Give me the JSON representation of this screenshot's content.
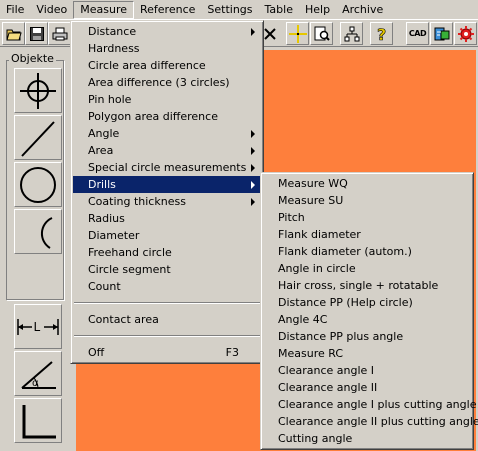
{
  "menubar": {
    "items": [
      "File",
      "Video",
      "Measure",
      "Reference",
      "Settings",
      "Table",
      "Help",
      "Archive"
    ],
    "active": "Measure"
  },
  "toolbar": {
    "left_icons": [
      "open-folder-icon",
      "save-icon",
      "print-icon"
    ],
    "right_icons": [
      "close-x-icon",
      "crosshair-icon",
      "zoom-document-icon",
      "network-icon",
      "help-icon",
      "cad-icon",
      "export-icon",
      "settings-gear-icon"
    ],
    "cad_label": "CAD"
  },
  "left_panel": {
    "group_label": "Objekte",
    "tools": [
      "crosshair-point-icon",
      "line-icon",
      "circle-icon",
      "arc-icon",
      "length-icon",
      "angle-icon",
      "corner-icon"
    ],
    "length_label": "L",
    "angle_label": "α"
  },
  "measure_menu": {
    "items": [
      {
        "label": "Distance",
        "submenu": true
      },
      {
        "label": "Hardness",
        "submenu": false
      },
      {
        "label": "Circle area difference",
        "submenu": false
      },
      {
        "label": "Area difference (3 circles)",
        "submenu": false
      },
      {
        "label": "Pin hole",
        "submenu": false
      },
      {
        "label": "Polygon area difference",
        "submenu": false
      },
      {
        "label": "Angle",
        "submenu": true
      },
      {
        "label": "Area",
        "submenu": true
      },
      {
        "label": "Special circle measurements",
        "submenu": true
      },
      {
        "label": "Drills",
        "submenu": true,
        "highlighted": true
      },
      {
        "label": "Coating thickness",
        "submenu": true
      },
      {
        "label": "Radius",
        "submenu": false
      },
      {
        "label": "Diameter",
        "submenu": false
      },
      {
        "label": "Freehand circle",
        "submenu": false
      },
      {
        "label": "Circle segment",
        "submenu": false
      },
      {
        "label": "Count",
        "submenu": false
      }
    ],
    "contact_area": "Contact area",
    "off": "Off",
    "off_shortcut": "F3"
  },
  "drills_submenu": {
    "items": [
      "Measure WQ",
      "Measure SU",
      "Pitch",
      "Flank diameter",
      "Flank diameter (autom.)",
      "Angle in circle",
      "Hair cross, single + rotatable",
      "Distance PP (Help circle)",
      "Angle 4C",
      "Distance PP plus angle",
      "Measure RC",
      "Clearance angle I",
      "Clearance angle II",
      "Clearance angle I plus cutting angle",
      "Clearance angle II plus cutting angle",
      "Cutting angle"
    ]
  },
  "colors": {
    "canvas": "#fe7f3c",
    "highlight": "#0a246a",
    "chrome": "#d4d0c8"
  }
}
